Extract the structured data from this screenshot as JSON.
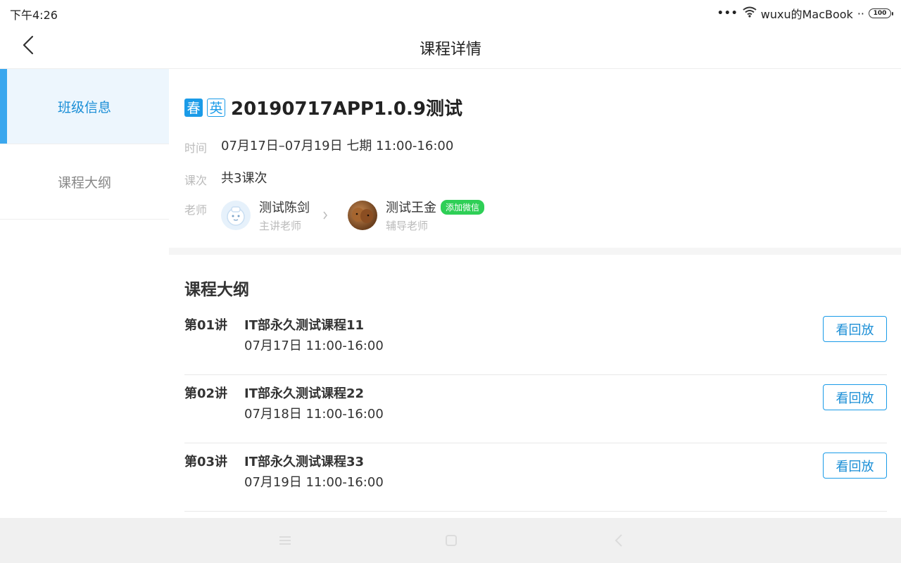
{
  "status_bar": {
    "time": "下午4:26",
    "dots": "•••",
    "network": "wuxu的MacBook",
    "network_suffix": "··",
    "battery": "100"
  },
  "header": {
    "title": "课程详情"
  },
  "sidebar": {
    "items": [
      {
        "label": "班级信息",
        "active": true
      },
      {
        "label": "课程大纲",
        "active": false
      }
    ]
  },
  "course": {
    "tags": [
      "春",
      "英"
    ],
    "title": "20190717APP1.0.9测试",
    "time_label": "时间",
    "time_value": "07月17日–07月19日 七期 11:00-16:00",
    "lessons_label": "课次",
    "lessons_value": "共3课次",
    "teacher_label": "老师",
    "teachers": [
      {
        "name": "测试陈剑",
        "role": "主讲老师"
      },
      {
        "name": "测试王金",
        "role": "辅导老师",
        "badge": "添加微信"
      }
    ]
  },
  "outline": {
    "title": "课程大纲",
    "replay_label": "看回放",
    "lessons": [
      {
        "number": "第01讲",
        "name": "IT部永久测试课程11",
        "time": "07月17日 11:00-16:00"
      },
      {
        "number": "第02讲",
        "name": "IT部永久测试课程22",
        "time": "07月18日 11:00-16:00"
      },
      {
        "number": "第03讲",
        "name": "IT部永久测试课程33",
        "time": "07月19日 11:00-16:00"
      }
    ]
  },
  "colors": {
    "accent": "#1a9be8",
    "active_bg": "#edf6fd",
    "wechat_green": "#2ecf56"
  },
  "icons": {
    "back": "chevron-left-icon",
    "wifi": "wifi-icon",
    "nav_menu": "menu-icon",
    "nav_home": "home-icon",
    "nav_back": "back-icon"
  }
}
